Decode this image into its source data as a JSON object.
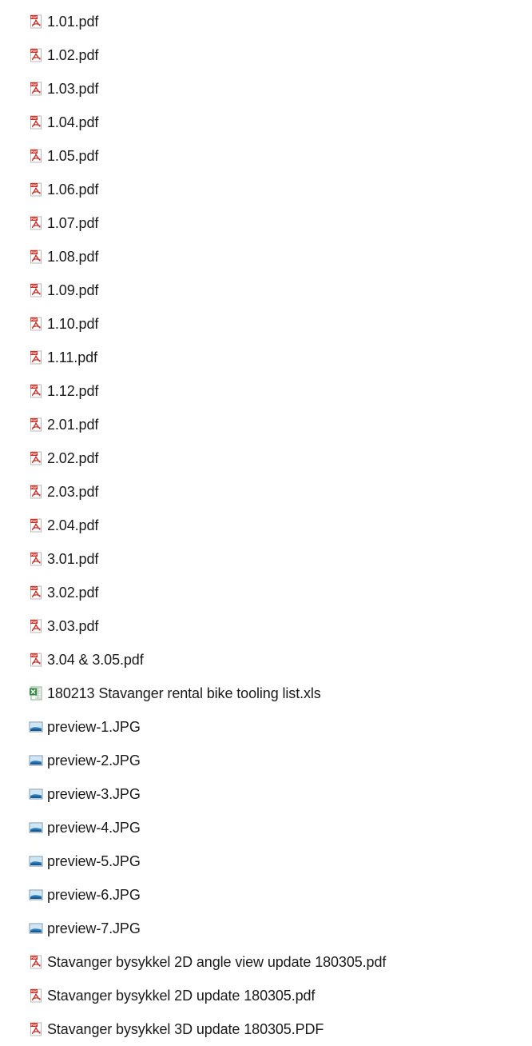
{
  "files": [
    {
      "name": "1.01.pdf",
      "icon": "pdf-icon"
    },
    {
      "name": "1.02.pdf",
      "icon": "pdf-icon"
    },
    {
      "name": "1.03.pdf",
      "icon": "pdf-icon"
    },
    {
      "name": "1.04.pdf",
      "icon": "pdf-icon"
    },
    {
      "name": "1.05.pdf",
      "icon": "pdf-icon"
    },
    {
      "name": "1.06.pdf",
      "icon": "pdf-icon"
    },
    {
      "name": "1.07.pdf",
      "icon": "pdf-icon"
    },
    {
      "name": "1.08.pdf",
      "icon": "pdf-icon"
    },
    {
      "name": "1.09.pdf",
      "icon": "pdf-icon"
    },
    {
      "name": "1.10.pdf",
      "icon": "pdf-icon"
    },
    {
      "name": "1.11.pdf",
      "icon": "pdf-icon"
    },
    {
      "name": "1.12.pdf",
      "icon": "pdf-icon"
    },
    {
      "name": "2.01.pdf",
      "icon": "pdf-icon"
    },
    {
      "name": "2.02.pdf",
      "icon": "pdf-icon"
    },
    {
      "name": "2.03.pdf",
      "icon": "pdf-icon"
    },
    {
      "name": "2.04.pdf",
      "icon": "pdf-icon"
    },
    {
      "name": "3.01.pdf",
      "icon": "pdf-icon"
    },
    {
      "name": "3.02.pdf",
      "icon": "pdf-icon"
    },
    {
      "name": "3.03.pdf",
      "icon": "pdf-icon"
    },
    {
      "name": "3.04 & 3.05.pdf",
      "icon": "pdf-icon"
    },
    {
      "name": "180213 Stavanger rental bike tooling list.xls",
      "icon": "excel-icon"
    },
    {
      "name": "preview-1.JPG",
      "icon": "image-icon"
    },
    {
      "name": "preview-2.JPG",
      "icon": "image-icon"
    },
    {
      "name": "preview-3.JPG",
      "icon": "image-icon"
    },
    {
      "name": "preview-4.JPG",
      "icon": "image-icon"
    },
    {
      "name": "preview-5.JPG",
      "icon": "image-icon"
    },
    {
      "name": "preview-6.JPG",
      "icon": "image-icon"
    },
    {
      "name": "preview-7.JPG",
      "icon": "image-icon"
    },
    {
      "name": "Stavanger bysykkel 2D angle view update 180305.pdf",
      "icon": "pdf-icon"
    },
    {
      "name": "Stavanger bysykkel 2D update 180305.pdf",
      "icon": "pdf-icon"
    },
    {
      "name": "Stavanger bysykkel 3D update 180305.PDF",
      "icon": "pdf-icon"
    }
  ],
  "colors": {
    "pdf_red": "#d42a1f",
    "excel_green": "#2f8a3c",
    "image_blue": "#2e7fc0"
  }
}
